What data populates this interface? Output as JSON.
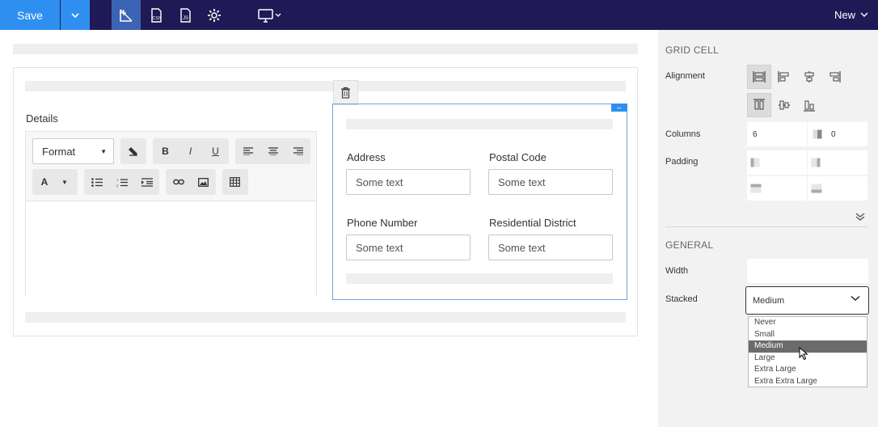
{
  "topbar": {
    "save_label": "Save",
    "new_label": "New",
    "tools": [
      "layout-icon",
      "css-icon",
      "js-icon",
      "gear-icon"
    ],
    "device_icon": "monitor-icon"
  },
  "canvas": {
    "details_label": "Details",
    "editor": {
      "format_label": "Format",
      "buttons": [
        "B",
        "I",
        "U"
      ],
      "font_color_label": "A"
    },
    "fields": [
      {
        "label": "Address",
        "placeholder": "Some text"
      },
      {
        "label": "Postal Code",
        "placeholder": "Some text"
      },
      {
        "label": "Phone Number",
        "placeholder": "Some text"
      },
      {
        "label": "Residential District",
        "placeholder": "Some text"
      }
    ]
  },
  "panel": {
    "grid_cell_heading": "GRID CELL",
    "alignment_label": "Alignment",
    "columns_label": "Columns",
    "columns_value": "6",
    "offset_value": "0",
    "padding_label": "Padding",
    "general_heading": "GENERAL",
    "width_label": "Width",
    "stacked_label": "Stacked",
    "stacked_value": "Medium",
    "stacked_options": [
      "Never",
      "Small",
      "Medium",
      "Large",
      "Extra Large",
      "Extra Extra Large"
    ],
    "stacked_selected_index": 2
  },
  "colors": {
    "topbar_bg": "#1f1a55",
    "accent": "#2f8ff0",
    "selection_border": "#6ea6e0"
  }
}
